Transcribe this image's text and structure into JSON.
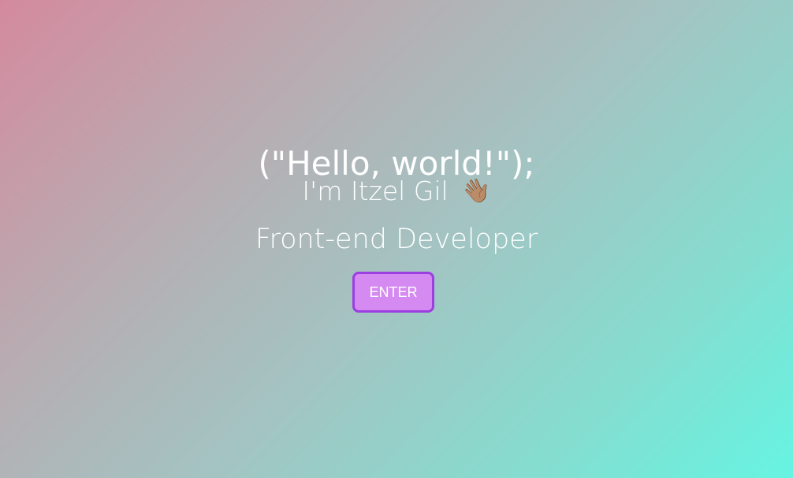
{
  "hero": {
    "greeting": "(\"Hello, world!\");",
    "intro_text": "I'm Itzel Gil",
    "wave_emoji": "👋🏽",
    "role": "Front-end Developer",
    "enter_label": "ENTER"
  },
  "colors": {
    "gradient_start": "#d48a9e",
    "gradient_end": "#66f4e2",
    "button_fill": "#d48af0",
    "button_border": "#9b3fe0",
    "text": "#ffffff"
  }
}
